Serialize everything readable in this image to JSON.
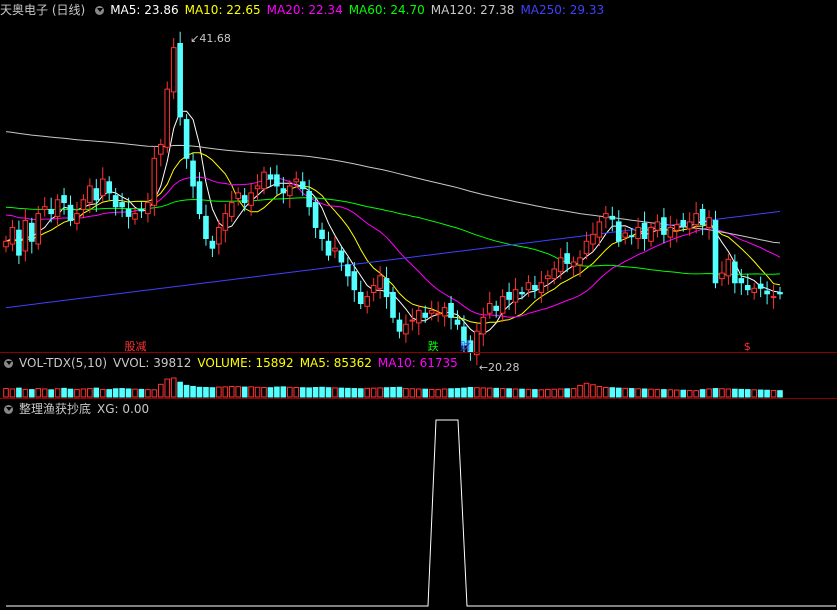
{
  "main_header": {
    "stock": "天奥电子 (日线)",
    "ma5": "MA5: 23.86",
    "ma10": "MA10: 22.65",
    "ma20": "MA20: 22.34",
    "ma60": "MA60: 24.70",
    "ma120": "MA120: 27.38",
    "ma250": "MA250: 29.33"
  },
  "vol_header": {
    "name": "VOL-TDX(5,10)",
    "vvol": "VVOL: 39812",
    "volume": "VOLUME: 15892",
    "ma5": "MA5: 85362",
    "ma10": "MA10: 61735"
  },
  "ind_header": {
    "name": "整理渔获抄底",
    "xg": "XG: 0.00"
  },
  "colors": {
    "up": "#ff3232",
    "down": "#54ffff",
    "ma5": "#ffffff",
    "ma10": "#ffff00",
    "ma20": "#ff00ff",
    "ma60": "#00ff00",
    "ma120": "#c8c8c8",
    "ma250": "#4040ff"
  },
  "chart_data": [
    {
      "type": "candlestick",
      "title": "天奥电子 (日线)",
      "annotations": [
        {
          "text": "41.68",
          "kind": "high"
        },
        {
          "text": "20.28",
          "kind": "low"
        }
      ],
      "markers": [
        {
          "text": "股减",
          "color": "#ff3232"
        },
        {
          "text": "跌",
          "color": "#00ff00"
        },
        {
          "text": "财",
          "color": "#4040ff"
        },
        {
          "text": "$",
          "color": "#ff3232"
        }
      ],
      "ylim": [
        19.5,
        43
      ],
      "close": [
        27,
        28,
        26,
        28.5,
        27,
        29,
        29.5,
        29,
        30,
        29.8,
        28.5,
        29,
        30,
        31,
        30,
        31.5,
        30.5,
        29.5,
        29.5,
        28.8,
        29,
        29.2,
        29.8,
        33,
        34,
        38,
        41,
        36,
        33,
        31,
        29,
        27.2,
        26.5,
        28,
        29,
        29.8,
        30.5,
        29.8,
        30.5,
        31,
        32,
        31.5,
        31,
        30.5,
        31,
        31.5,
        30.8,
        29.5,
        28,
        27.2,
        26,
        26.5,
        25.5,
        24.5,
        23.5,
        22.5,
        23,
        23.8,
        24.5,
        23,
        21.5,
        20.5,
        21,
        21.3,
        22,
        21.5,
        22,
        21.8,
        22.2,
        21.5,
        21,
        19.5,
        19,
        20.5,
        21.5,
        22.5,
        22,
        23,
        22.8,
        23.5,
        23.2,
        24,
        23.5,
        24,
        24.5,
        25,
        25.8,
        25.4,
        25.5,
        25.8,
        27,
        27.5,
        28.4,
        29,
        28.6,
        27,
        27.6,
        27.4,
        28,
        27.2,
        28,
        28.4,
        27.5,
        28,
        28.2,
        28.1,
        28.4,
        29,
        28.2,
        28.7,
        24,
        24.7,
        25.7,
        24,
        24,
        23.5,
        23.6,
        23.6,
        23.2,
        23,
        23.2
      ]
    },
    {
      "type": "bar",
      "title": "VOL-TDX(5,10)",
      "values": [
        40,
        38,
        42,
        36,
        35,
        40,
        38,
        34,
        39,
        41,
        37,
        36,
        38,
        40,
        42,
        36,
        35,
        39,
        40,
        38,
        37,
        36,
        35,
        34,
        60,
        85,
        90,
        70,
        55,
        50,
        46,
        45,
        44,
        47,
        48,
        50,
        49,
        47,
        48,
        46,
        45,
        44,
        47,
        48,
        46,
        45,
        44,
        43,
        45,
        46,
        44,
        43,
        42,
        41,
        40,
        39,
        41,
        42,
        43,
        44,
        45,
        46,
        40,
        39,
        38,
        37,
        36,
        35,
        38,
        39,
        40,
        42,
        45,
        44,
        43,
        42,
        41,
        40,
        39,
        38,
        37,
        36,
        35,
        34,
        36,
        37,
        38,
        39,
        40,
        55,
        65,
        58,
        50,
        45,
        44,
        42,
        41,
        40,
        39,
        38,
        37,
        36,
        35,
        34,
        33,
        32,
        31,
        30,
        35,
        38,
        40,
        39,
        38,
        37,
        36,
        35,
        34,
        33,
        32,
        31,
        30,
        29,
        28,
        27,
        26,
        25,
        24,
        23,
        22,
        21
      ]
    },
    {
      "type": "line",
      "title": "整理渔获抄底",
      "values": [
        0,
        1,
        1,
        0
      ]
    }
  ]
}
